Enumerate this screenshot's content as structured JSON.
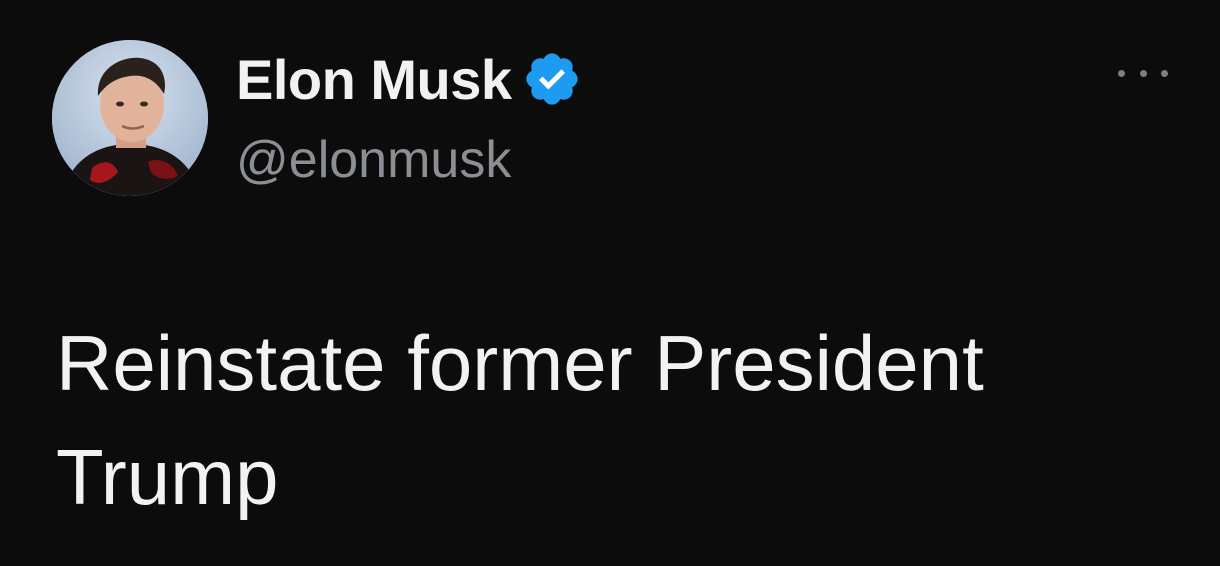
{
  "author": {
    "display_name": "Elon Musk",
    "handle": "@elonmusk",
    "verified": true,
    "avatar_icon": "profile-photo"
  },
  "menu": {
    "icon": "more-horizontal-icon"
  },
  "tweet": {
    "text": "Reinstate former President Trump"
  },
  "colors": {
    "background": "#0c0c0c",
    "text": "#f2f2f2",
    "secondary_text": "#8b8f94",
    "verified_badge": "#1d9bf0"
  }
}
